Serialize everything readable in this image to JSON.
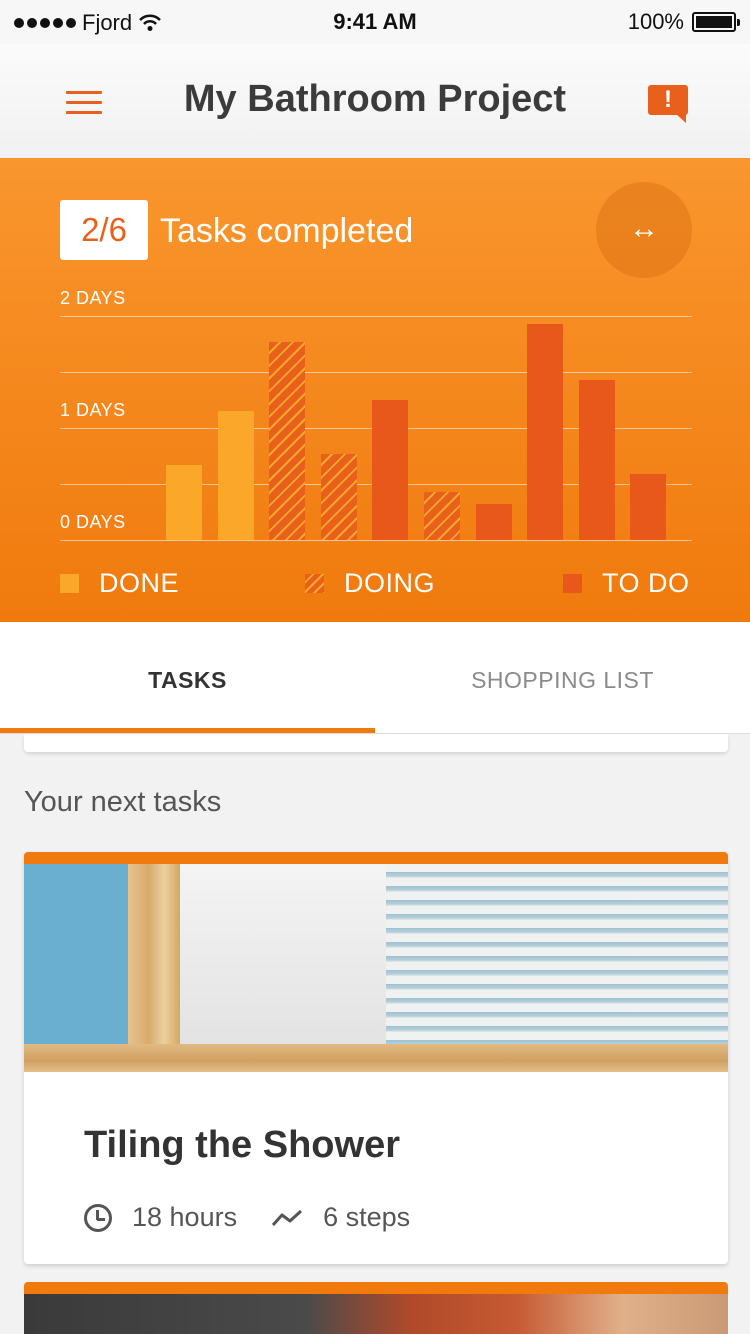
{
  "status_bar": {
    "carrier": "Fjord",
    "time": "9:41 AM",
    "battery": "100%"
  },
  "header": {
    "title": "My Bathroom Project",
    "menu_icon": "hamburger-menu-icon",
    "alert_icon": "alert-icon",
    "alert_glyph": "!"
  },
  "progress": {
    "count": "2/6",
    "label": "Tasks completed",
    "swap_glyph": "↔"
  },
  "colors": {
    "accent": "#f07a0d",
    "done": "#fba82a",
    "todo": "#e8581b"
  },
  "chart_data": {
    "type": "bar",
    "title": "",
    "xlabel": "",
    "ylabel": "",
    "ylim": [
      0,
      2
    ],
    "y_ticks": [
      {
        "value": 2,
        "label": "2 DAYS"
      },
      {
        "value": 1,
        "label": "1 DAYS"
      },
      {
        "value": 0,
        "label": "0 DAYS"
      }
    ],
    "grid": true,
    "bars": [
      {
        "status": "done",
        "value": 0.67
      },
      {
        "status": "done",
        "value": 1.15
      },
      {
        "status": "doing",
        "value": 1.77
      },
      {
        "status": "doing",
        "value": 0.77
      },
      {
        "status": "todo",
        "value": 1.25
      },
      {
        "status": "doing",
        "value": 0.43
      },
      {
        "status": "todo",
        "value": 0.32
      },
      {
        "status": "todo",
        "value": 1.93
      },
      {
        "status": "todo",
        "value": 1.43
      },
      {
        "status": "todo",
        "value": 0.59
      }
    ],
    "legend": [
      {
        "key": "done",
        "label": "DONE"
      },
      {
        "key": "doing",
        "label": "DOING"
      },
      {
        "key": "todo",
        "label": "TO DO"
      }
    ]
  },
  "tabs": [
    {
      "label": "TASKS",
      "active": true
    },
    {
      "label": "SHOPPING LIST",
      "active": false
    }
  ],
  "content": {
    "section_title": "Your next tasks",
    "cards": [
      {
        "title": "Tiling the Shower",
        "duration": "18 hours",
        "steps": "6 steps",
        "duration_icon": "clock-icon",
        "steps_icon": "steps-icon"
      }
    ]
  }
}
